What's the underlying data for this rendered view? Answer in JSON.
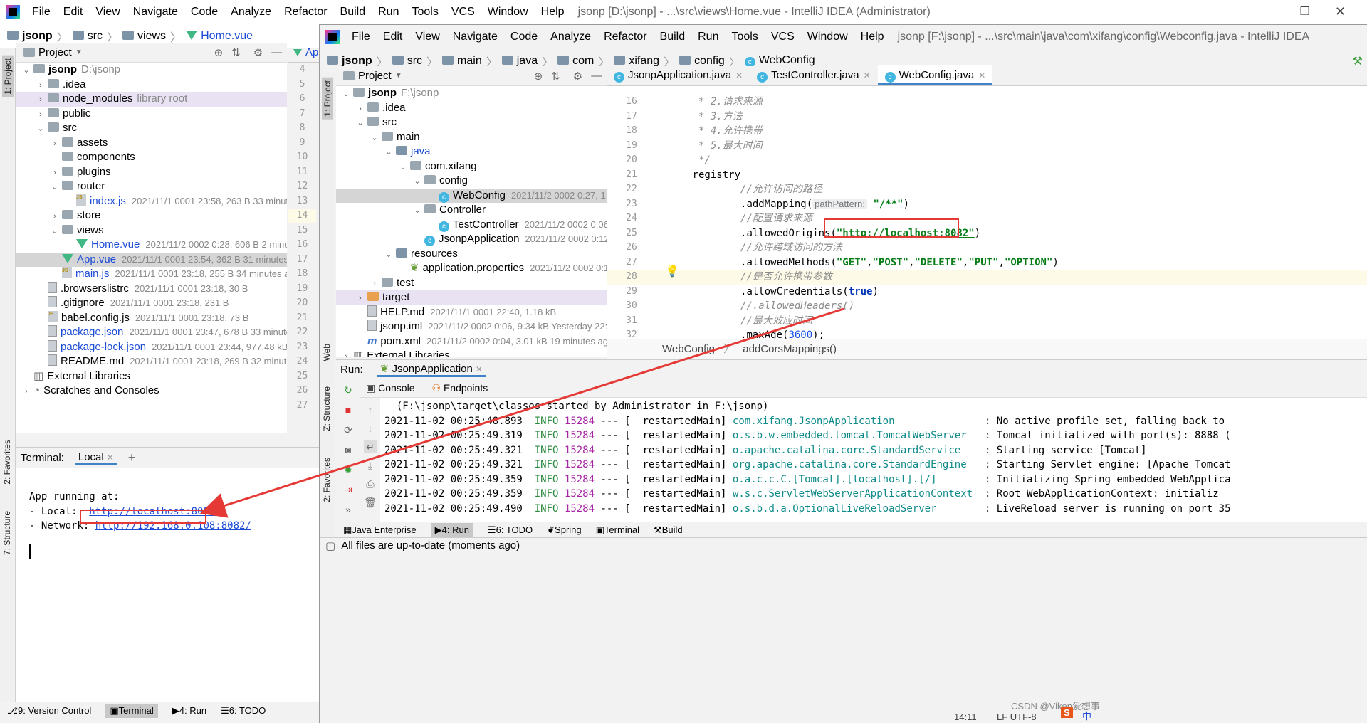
{
  "left_window": {
    "title": "jsonp [D:\\jsonp] - ...\\src\\views\\Home.vue - IntelliJ IDEA (Administrator)",
    "menu": [
      "File",
      "Edit",
      "View",
      "Navigate",
      "Code",
      "Analyze",
      "Refactor",
      "Build",
      "Run",
      "Tools",
      "VCS",
      "Window",
      "Help"
    ],
    "breadcrumb": [
      "jsonp",
      "src",
      "views",
      "Home.vue"
    ],
    "project_label": "Project",
    "tree": [
      {
        "name": "jsonp",
        "extra": "D:\\jsonp",
        "meta": ""
      },
      {
        "name": ".idea",
        "extra": "",
        "meta": ""
      },
      {
        "name": "node_modules",
        "extra": "library root",
        "meta": ""
      },
      {
        "name": "public",
        "extra": "",
        "meta": ""
      },
      {
        "name": "src",
        "extra": "",
        "meta": ""
      },
      {
        "name": "assets",
        "extra": "",
        "meta": ""
      },
      {
        "name": "components",
        "extra": "",
        "meta": ""
      },
      {
        "name": "plugins",
        "extra": "",
        "meta": ""
      },
      {
        "name": "router",
        "extra": "",
        "meta": ""
      },
      {
        "name": "index.js",
        "extra": "",
        "meta": "2021/11/1 0001 23:58, 263 B 33 minutes ag"
      },
      {
        "name": "store",
        "extra": "",
        "meta": ""
      },
      {
        "name": "views",
        "extra": "",
        "meta": ""
      },
      {
        "name": "Home.vue",
        "extra": "",
        "meta": "2021/11/2 0002 0:28, 606 B 2 minutes a"
      },
      {
        "name": "App.vue",
        "extra": "",
        "meta": "2021/11/1 0001 23:54, 362 B 31 minutes ago"
      },
      {
        "name": "main.js",
        "extra": "",
        "meta": "2021/11/1 0001 23:18, 255 B 34 minutes ago"
      },
      {
        "name": ".browserslistrc",
        "extra": "",
        "meta": "2021/11/1 0001 23:18, 30 B"
      },
      {
        "name": ".gitignore",
        "extra": "",
        "meta": "2021/11/1 0001 23:18, 231 B"
      },
      {
        "name": "babel.config.js",
        "extra": "",
        "meta": "2021/11/1 0001 23:18, 73 B"
      },
      {
        "name": "package.json",
        "extra": "",
        "meta": "2021/11/1 0001 23:47, 678 B 33 minutes ago"
      },
      {
        "name": "package-lock.json",
        "extra": "",
        "meta": "2021/11/1 0001 23:44, 977.48 kB"
      },
      {
        "name": "README.md",
        "extra": "",
        "meta": "2021/11/1 0001 23:18, 269 B 32 minutes ago"
      },
      {
        "name": "External Libraries",
        "extra": "",
        "meta": ""
      },
      {
        "name": "Scratches and Consoles",
        "extra": "",
        "meta": ""
      }
    ],
    "gutter": [
      "4",
      "5",
      "6",
      "7",
      "8",
      "9",
      "10",
      "11",
      "12",
      "13",
      "14",
      "15",
      "16",
      "17",
      "18",
      "19",
      "20",
      "21",
      "22",
      "23",
      "24",
      "25",
      "26",
      "27"
    ],
    "editor_tab_fragment": "Ap",
    "terminal": {
      "label": "Terminal:",
      "tab": "Local",
      "add": "+",
      "app_running": "App running at:",
      "local_label": "- Local:",
      "local_url": "http://localhost:8082/",
      "network_label": "- Network:",
      "network_url": "http://192.168.0.108:8082/"
    },
    "side_tabs": {
      "project": "1: Project",
      "favorites": "2: Favorites",
      "structure": "7: Structure"
    },
    "bottom_tabs": [
      "9: Version Control",
      "Terminal",
      "4: Run",
      "6: TODO"
    ]
  },
  "right_window": {
    "title": "jsonp [F:\\jsonp] - ...\\src\\main\\java\\com\\xifang\\config\\Webconfig.java - IntelliJ IDEA",
    "menu": [
      "File",
      "Edit",
      "View",
      "Navigate",
      "Code",
      "Analyze",
      "Refactor",
      "Build",
      "Run",
      "Tools",
      "VCS",
      "Window",
      "Help"
    ],
    "breadcrumb": [
      "jsonp",
      "src",
      "main",
      "java",
      "com",
      "xifang",
      "config",
      "WebConfig"
    ],
    "project_label": "Project",
    "editor_tabs": [
      "JsonpApplication.java",
      "TestController.java",
      "WebConfig.java"
    ],
    "tree": [
      {
        "name": "jsonp",
        "extra": "F:\\jsonp",
        "meta": ""
      },
      {
        "name": ".idea",
        "extra": "",
        "meta": ""
      },
      {
        "name": "src",
        "extra": "",
        "meta": ""
      },
      {
        "name": "main",
        "extra": "",
        "meta": ""
      },
      {
        "name": "java",
        "extra": "",
        "meta": ""
      },
      {
        "name": "com.xifang",
        "extra": "",
        "meta": ""
      },
      {
        "name": "config",
        "extra": "",
        "meta": ""
      },
      {
        "name": "WebConfig",
        "extra": "",
        "meta": "2021/11/2 0002 0:27, 1.08"
      },
      {
        "name": "Controller",
        "extra": "",
        "meta": ""
      },
      {
        "name": "TestController",
        "extra": "",
        "meta": "2021/11/2 0002 0:06, 3"
      },
      {
        "name": "JsonpApplication",
        "extra": "",
        "meta": "2021/11/2 0002 0:12, 43"
      },
      {
        "name": "resources",
        "extra": "",
        "meta": ""
      },
      {
        "name": "application.properties",
        "extra": "",
        "meta": "2021/11/2 0002 0:12,"
      },
      {
        "name": "test",
        "extra": "",
        "meta": ""
      },
      {
        "name": "target",
        "extra": "",
        "meta": ""
      },
      {
        "name": "HELP.md",
        "extra": "",
        "meta": "2021/11/1 0001 22:40, 1.18 kB"
      },
      {
        "name": "jsonp.iml",
        "extra": "",
        "meta": "2021/11/2 0002 0:06, 9.34 kB Yesterday 22:47"
      },
      {
        "name": "pom.xml",
        "extra": "",
        "meta": "2021/11/2 0002 0:04, 3.01 kB 19 minutes ago"
      },
      {
        "name": "External Libraries",
        "extra": "",
        "meta": ""
      }
    ],
    "gutter": [
      "16",
      "17",
      "18",
      "19",
      "20",
      "21",
      "22",
      "23",
      "24",
      "25",
      "26",
      "27",
      "28",
      "29",
      "30",
      "31",
      "32"
    ],
    "code": {
      "c2": "* 2.请求来源",
      "c3": "* 3.方法",
      "c4": "* 4.允许携带",
      "c5": "* 5.最大时间",
      "cend": "*/",
      "registry": "registry",
      "cpath": "//允许访问的路径",
      "addMapping": ".addMapping(",
      "hint": "pathPattern:",
      "mapping_val": "\"/**\"",
      "corigin": "//配置请求来源",
      "allowedOrigins": ".allowedOrigins(",
      "origin_val": "\"http://localhost:8082\"",
      "cmethods": "//允许跨域访问的方法",
      "allowedMethods": ".allowedMethods(",
      "methods_vals": [
        "\"GET\"",
        "\"POST\"",
        "\"DELETE\"",
        "\"PUT\"",
        "\"OPTION\""
      ],
      "ccred": "//是否允许携带参数",
      "allowCredentials": ".allowCredentials(",
      "cred_val": "true",
      "cheaders": "//.allowedHeaders()",
      "cmaxage": "//最大效应时间",
      "maxAge": ".maxAge(",
      "maxage_val": "3600",
      "close_paren": ")",
      "close_semi": ");"
    },
    "editor_breadcrumb": [
      "WebConfig",
      "addCorsMappings()"
    ],
    "run": {
      "label": "Run:",
      "config": "JsonpApplication",
      "tabs": [
        "Console",
        "Endpoints"
      ],
      "first_line": "(F:\\jsonp\\target\\classes started by Administrator in F:\\jsonp)",
      "logs": [
        {
          "time": "2021-11-02 00:25:48.893",
          "level": "INFO",
          "pid": "15284",
          "sep": "--- [  restartedMain]",
          "cls": "com.xifang.JsonpApplication",
          "msg": ": No active profile set, falling back to"
        },
        {
          "time": "2021-11-02 00:25:49.319",
          "level": "INFO",
          "pid": "15284",
          "sep": "--- [  restartedMain]",
          "cls": "o.s.b.w.embedded.tomcat.TomcatWebServer",
          "msg": ": Tomcat initialized with port(s): 8888 ("
        },
        {
          "time": "2021-11-02 00:25:49.321",
          "level": "INFO",
          "pid": "15284",
          "sep": "--- [  restartedMain]",
          "cls": "o.apache.catalina.core.StandardService",
          "msg": ": Starting service [Tomcat]"
        },
        {
          "time": "2021-11-02 00:25:49.321",
          "level": "INFO",
          "pid": "15284",
          "sep": "--- [  restartedMain]",
          "cls": "org.apache.catalina.core.StandardEngine",
          "msg": ": Starting Servlet engine: [Apache Tomcat"
        },
        {
          "time": "2021-11-02 00:25:49.359",
          "level": "INFO",
          "pid": "15284",
          "sep": "--- [  restartedMain]",
          "cls": "o.a.c.c.C.[Tomcat].[localhost].[/]",
          "msg": ": Initializing Spring embedded WebApplica"
        },
        {
          "time": "2021-11-02 00:25:49.359",
          "level": "INFO",
          "pid": "15284",
          "sep": "--- [  restartedMain]",
          "cls": "w.s.c.ServletWebServerApplicationContext",
          "msg": ": Root WebApplicationContext: initializ"
        },
        {
          "time": "2021-11-02 00:25:49.490",
          "level": "INFO",
          "pid": "15284",
          "sep": "--- [  restartedMain]",
          "cls": "o.s.b.d.a.OptionalLiveReloadServer",
          "msg": ": LiveReload server is running on port 35"
        }
      ]
    },
    "side_tabs": {
      "project": "1: Project",
      "web": "Web",
      "structure": "Z: Structure",
      "favorites": "2: Favorites"
    },
    "bottom_tabs": [
      "Java Enterprise",
      "4: Run",
      "6: TODO",
      "Spring",
      "Terminal",
      "Build"
    ],
    "status": "All files are up-to-date (moments ago)"
  },
  "taskbar": {
    "ime": "中",
    "time": "14:11",
    "encoding": "LF  UTF-8",
    "watermark": "CSDN @Viken爱想事"
  },
  "colors": {
    "annotation_red": "#e53935",
    "accent_blue": "#4083c9",
    "vue_green": "#41b883"
  }
}
